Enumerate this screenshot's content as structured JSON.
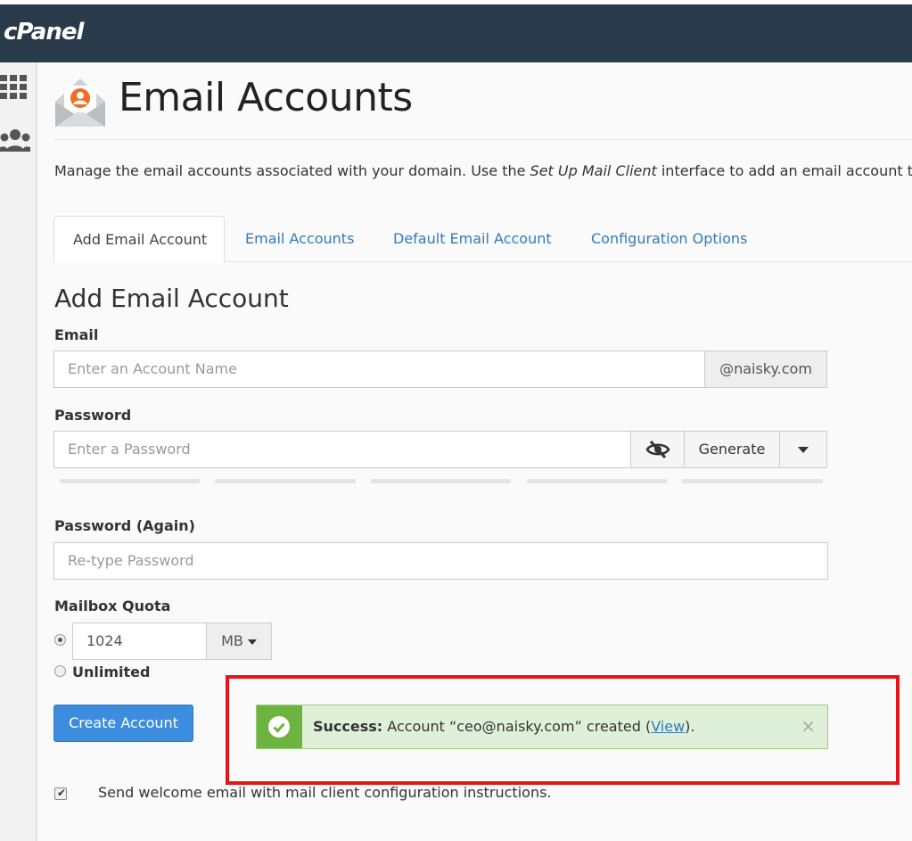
{
  "brand": {
    "logo": "cPanel"
  },
  "page": {
    "title": "Email Accounts",
    "description_before": "Manage the email accounts associated with your domain. Use the ",
    "description_em": "Set Up Mail Client",
    "description_after": " interface to add an email account t"
  },
  "tabs": [
    {
      "label": "Add Email Account",
      "active": true
    },
    {
      "label": "Email Accounts",
      "active": false
    },
    {
      "label": "Default Email Account",
      "active": false
    },
    {
      "label": "Configuration Options",
      "active": false
    }
  ],
  "form": {
    "section_title": "Add Email Account",
    "email": {
      "label": "Email",
      "placeholder": "Enter an Account Name",
      "domain_suffix": "@naisky.com"
    },
    "password": {
      "label": "Password",
      "placeholder": "Enter a Password",
      "generate_label": "Generate"
    },
    "password_again": {
      "label": "Password (Again)",
      "placeholder": "Re-type Password"
    },
    "quota": {
      "label": "Mailbox Quota",
      "value": "1024",
      "unit": "MB",
      "unlimited_label": "Unlimited",
      "selected": "value"
    },
    "create_button": "Create Account",
    "welcome_email": {
      "checked": true,
      "label": "Send welcome email with mail client configuration instructions."
    }
  },
  "alert": {
    "title": "Success:",
    "message_before": " Account “ceo@naisky.com” created (",
    "link": "View",
    "message_after": ").",
    "close": "×"
  },
  "colors": {
    "topbar": "#293a4a",
    "link": "#337ab7",
    "primary": "#3c8dde",
    "success_bg": "#dff0d8",
    "success_icon": "#6db33f",
    "highlight": "#e3151b"
  }
}
